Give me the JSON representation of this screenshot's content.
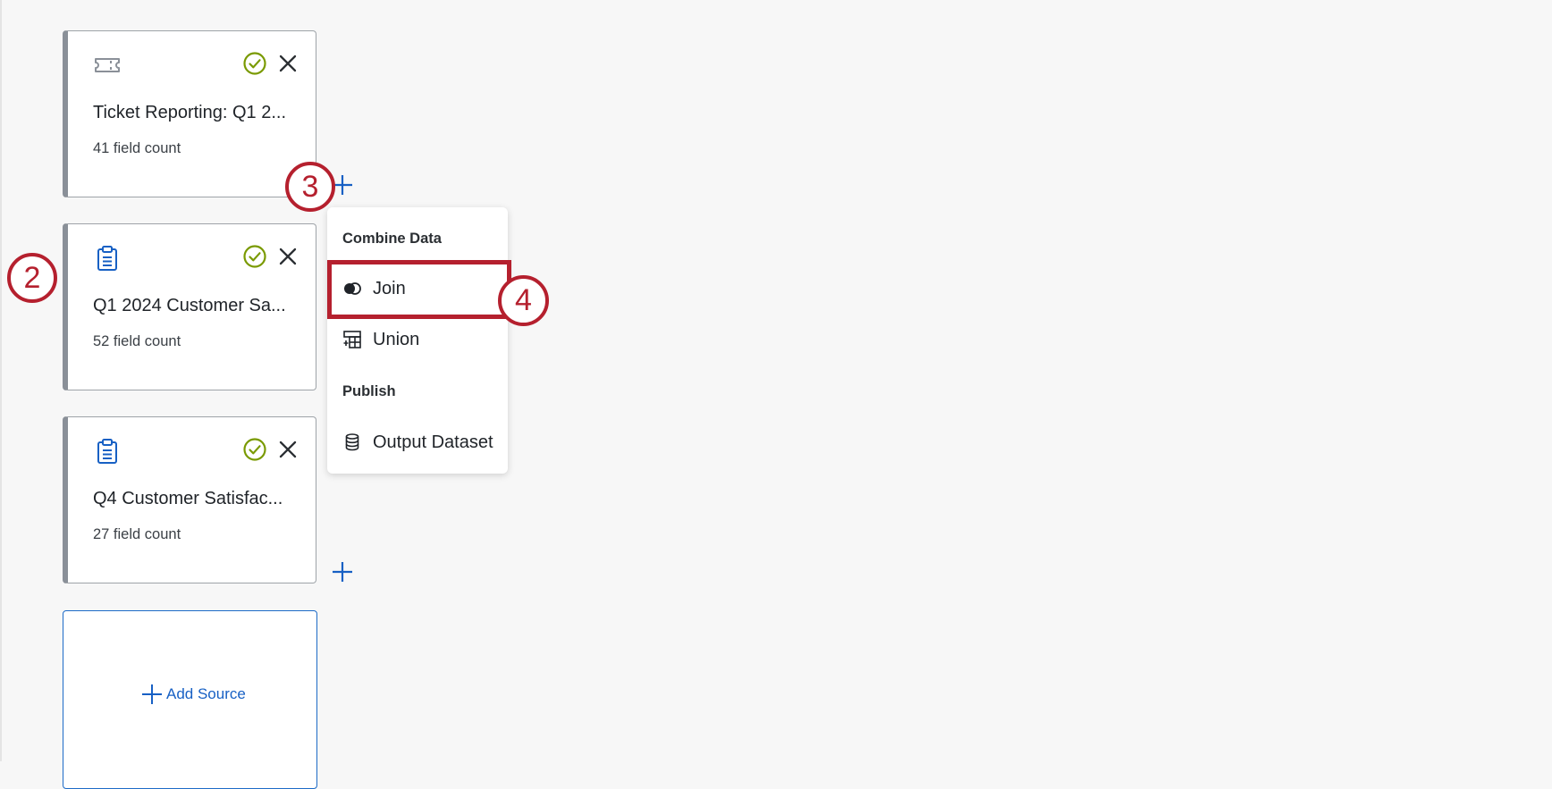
{
  "sources": [
    {
      "title": "Ticket Reporting: Q1 2...",
      "field_count": "41 field count",
      "icon": "ticket-icon"
    },
    {
      "title": "Q1 2024 Customer Sa...",
      "field_count": "52 field count",
      "icon": "clipboard-icon"
    },
    {
      "title": "Q4 Customer Satisfac...",
      "field_count": "27 field count",
      "icon": "clipboard-icon"
    }
  ],
  "add_source": {
    "label": "Add Source"
  },
  "menu": {
    "combine_heading": "Combine Data",
    "join_label": "Join",
    "union_label": "Union",
    "publish_heading": "Publish",
    "output_label": "Output Dataset"
  },
  "callouts": {
    "two": "2",
    "three": "3",
    "four": "4"
  },
  "colors": {
    "accent_blue": "#1760c4",
    "status_green": "#7a9a01",
    "callout_red": "#b5202e",
    "card_border": "#9ea3a8"
  }
}
